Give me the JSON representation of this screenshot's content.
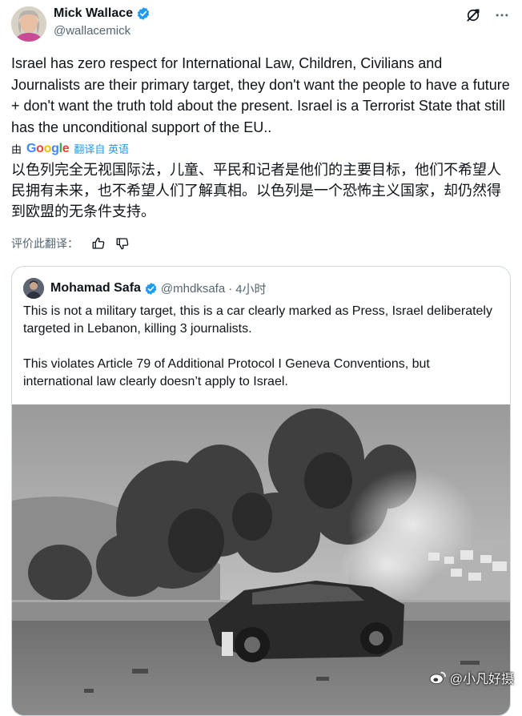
{
  "author": {
    "name": "Mick Wallace",
    "handle": "@wallacemick"
  },
  "icons": {
    "verified": "verified-badge-icon",
    "grok": "grok-icon",
    "more": "more-icon",
    "thumb_up": "thumbs-up-icon",
    "thumb_down": "thumbs-down-icon",
    "watermark": "weibo-icon"
  },
  "tweet": {
    "text": "Israel has zero respect for International Law, Children, Civilians and Journalists are their primary target, they don't want the people to have a future + don't want the truth told about the present. Israel is a Terrorist State that still has the unconditional support of the EU.."
  },
  "translation": {
    "by": "由",
    "provider": "Google",
    "action": "翻译自 英语",
    "text": "以色列完全无视国际法，儿童、平民和记者是他们的主要目标，他们不希望人民拥有未来，也不希望人们了解真相。以色列是一个恐怖主义国家，却仍然得到欧盟的无条件支持。",
    "rate_label": "评价此翻译："
  },
  "quote": {
    "name": "Mohamad Safa",
    "handle": "@mhdksafa",
    "separator": "·",
    "time": "4小时",
    "paragraph1": "This is not a military target, this is a car clearly marked as Press, Israel deliberately targeted in Lebanon, killing 3 journalists.",
    "paragraph2": "This violates Article 79 of Additional Protocol I Geneva Conventions, but international law clearly doesn’t apply to Israel."
  },
  "watermark": {
    "text": "@小凡好摄"
  },
  "colors": {
    "verified": "#1d9bf0",
    "link": "#1d9bf0",
    "secondary_text": "#536471",
    "border": "#cfd9de"
  }
}
